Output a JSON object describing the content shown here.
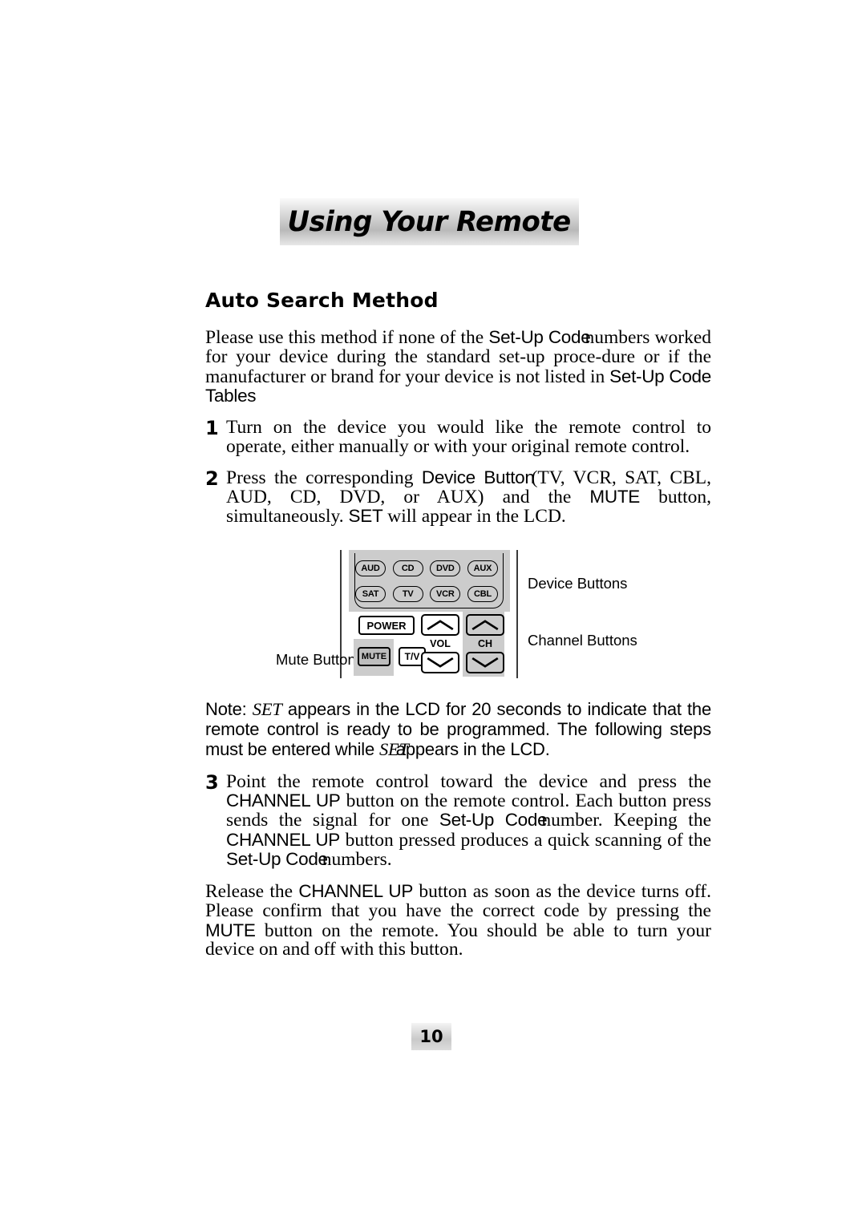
{
  "header": {
    "title": "Using Your Remote"
  },
  "section": {
    "heading": "Auto Search Method",
    "intro": {
      "part1": "Please use this method if none of the ",
      "term1": "Set-Up Code",
      "part2": "numbers worked for your device during the standard set-up proce-dure or if the manufacturer or brand for your device is not listed in ",
      "term2": "Set-Up Code Tables"
    }
  },
  "steps": [
    {
      "number": "1",
      "text": "Turn on the device you would like the remote control to operate, either manually or with your original remote control."
    },
    {
      "number": "2",
      "part1": "Press the corresponding ",
      "term1": "Device Button",
      "part2": "(TV, VCR, SAT, CBL, AUD, CD, DVD, or AUX) and the ",
      "term2": "MUTE",
      "part3": " button, simultaneously. ",
      "term3": "SET",
      "part4": " will appear in the LCD."
    },
    {
      "number": "3",
      "part1": "Point the remote control toward the device and press the ",
      "term1": "CHANNEL UP",
      "part2": " button on the remote control. Each button press sends the signal for one ",
      "term2": "Set-Up Code",
      "part3": "number. Keeping the ",
      "term3": "CHANNEL UP",
      "part4": " button pressed produces a quick scanning of the ",
      "term4": "Set-Up Code",
      "part5": "numbers."
    }
  ],
  "note": {
    "label": "Note: ",
    "term1": "SET",
    "part1": " appears in the LCD for 20 seconds to indicate that the remote control is ready to be programmed. The following steps must be entered while ",
    "term2": "SET",
    "part2": " appears in the LCD."
  },
  "closing": {
    "part1": "Release the ",
    "term1": "CHANNEL UP",
    "part2": " button as soon as the device turns off. Please confirm that you have the correct code by pressing the ",
    "term2": "MUTE",
    "part3": " button on the remote. You should be able to turn your device on and off with this button."
  },
  "diagram": {
    "callouts": {
      "mute": "Mute Button",
      "device": "Device Buttons",
      "channel": "Channel Buttons"
    },
    "device_buttons_row1": [
      "AUD",
      "CD",
      "DVD",
      "AUX"
    ],
    "device_buttons_row2": [
      "SAT",
      "TV",
      "VCR",
      "CBL"
    ],
    "power_label": "POWER",
    "mute_label": "MUTE",
    "tv_label": "T/V",
    "vol_label": "VOL",
    "ch_label": "CH"
  },
  "footer": {
    "page_number": "10"
  },
  "colors": {
    "panel_gray": "#cccccc",
    "highlight_gray": "#cccccc",
    "mute_fill": "#bdbdbd",
    "ink": "#000000"
  }
}
